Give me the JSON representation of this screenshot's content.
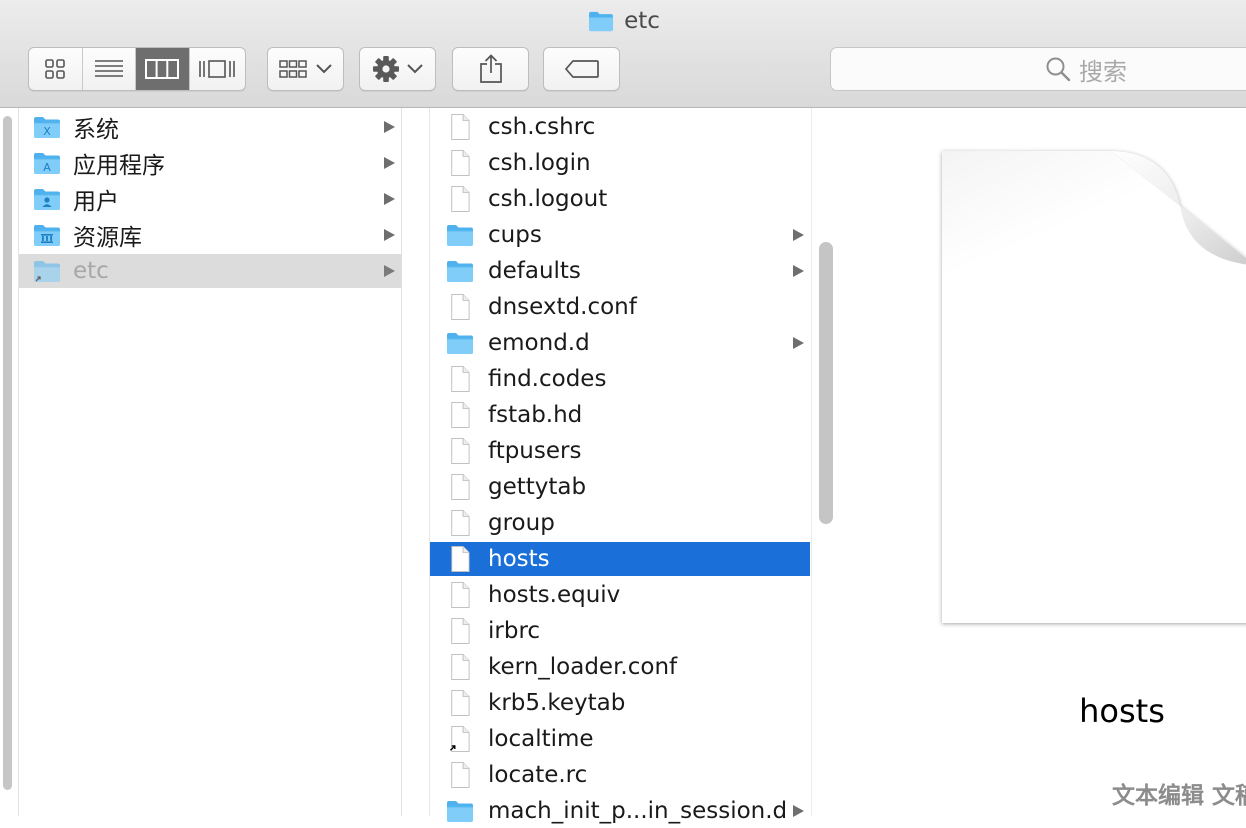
{
  "window": {
    "title": "etc"
  },
  "toolbar": {
    "view_modes": [
      {
        "name": "icon-view",
        "icon": "grid-icon",
        "active": false
      },
      {
        "name": "list-view",
        "icon": "list-icon",
        "active": false
      },
      {
        "name": "column-view",
        "icon": "columns-icon",
        "active": true
      },
      {
        "name": "cover-flow-view",
        "icon": "coverflow-icon",
        "active": false
      }
    ],
    "arrange_icon": "arrange-grid-icon",
    "action_icon": "gear-icon",
    "share_icon": "share-icon",
    "tags_icon": "tag-icon",
    "search_placeholder": "搜索"
  },
  "sidebar_column": {
    "items": [
      {
        "label": "系统",
        "icon": "system-folder-icon",
        "has_children": true,
        "state": "normal"
      },
      {
        "label": "应用程序",
        "icon": "applications-folder-icon",
        "has_children": true,
        "state": "normal"
      },
      {
        "label": "用户",
        "icon": "users-folder-icon",
        "has_children": true,
        "state": "normal"
      },
      {
        "label": "资源库",
        "icon": "library-folder-icon",
        "has_children": true,
        "state": "normal"
      },
      {
        "label": "etc",
        "icon": "alias-folder-icon",
        "has_children": true,
        "state": "inactive-selected"
      }
    ]
  },
  "file_column": {
    "items": [
      {
        "label": "csh.cshrc",
        "type": "file"
      },
      {
        "label": "csh.login",
        "type": "file"
      },
      {
        "label": "csh.logout",
        "type": "file"
      },
      {
        "label": "cups",
        "type": "folder"
      },
      {
        "label": "defaults",
        "type": "folder"
      },
      {
        "label": "dnsextd.conf",
        "type": "file"
      },
      {
        "label": "emond.d",
        "type": "folder"
      },
      {
        "label": "find.codes",
        "type": "file"
      },
      {
        "label": "fstab.hd",
        "type": "file"
      },
      {
        "label": "ftpusers",
        "type": "file"
      },
      {
        "label": "gettytab",
        "type": "file"
      },
      {
        "label": "group",
        "type": "file"
      },
      {
        "label": "hosts",
        "type": "file",
        "selected": true
      },
      {
        "label": "hosts.equiv",
        "type": "file"
      },
      {
        "label": "irbrc",
        "type": "file"
      },
      {
        "label": "kern_loader.conf",
        "type": "file"
      },
      {
        "label": "krb5.keytab",
        "type": "file"
      },
      {
        "label": "localtime",
        "type": "alias"
      },
      {
        "label": "locate.rc",
        "type": "file"
      },
      {
        "label": "mach_init_p...in_session.d",
        "type": "folder"
      }
    ]
  },
  "preview": {
    "file_name": "hosts",
    "kind": "文本编辑 文稿"
  },
  "colors": {
    "selection": "#1b6fd8",
    "folder": "#5ebcf2",
    "inactive_selection": "#dcdcdc"
  }
}
